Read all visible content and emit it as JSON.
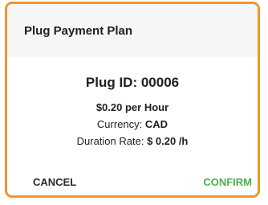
{
  "dialog": {
    "title": "Plug Payment Plan",
    "plug_id": "Plug ID: 00006",
    "rate": "$0.20 per Hour",
    "currency_label": "Currency:",
    "currency_value": "CAD",
    "duration_label": "Duration Rate:",
    "duration_value": "$ 0.20 /h",
    "cancel_label": "CANCEL",
    "confirm_label": "CONFIRM"
  },
  "colors": {
    "border": "#f0962e",
    "confirm": "#4caf50",
    "header_bg": "#f6f6f6"
  }
}
